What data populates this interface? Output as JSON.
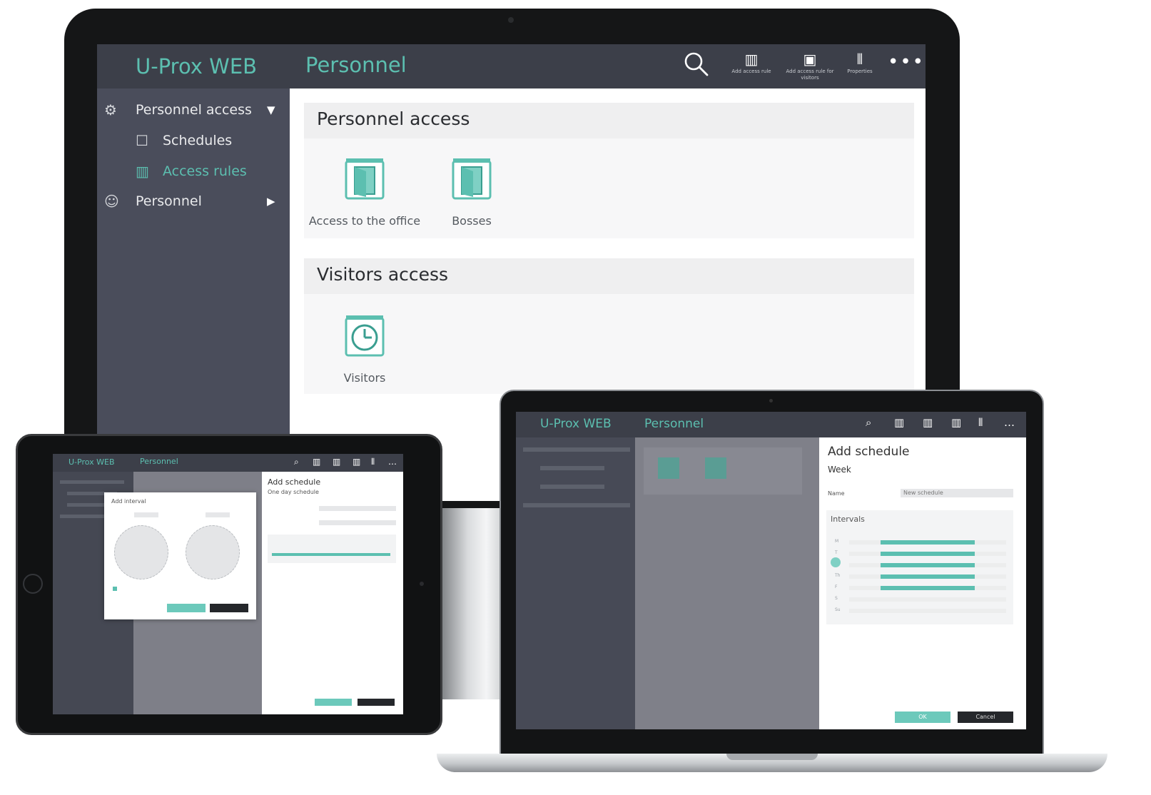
{
  "monitor": {
    "app_title": "U-Prox WEB",
    "section_title": "Personnel",
    "toolbar": {
      "add_access_rule": "Add access rule",
      "add_access_rule_visitors": "Add access rule for visitors",
      "properties": "Properties",
      "more": "•••"
    },
    "sidebar": {
      "items": [
        {
          "label": "Personnel access",
          "icon": "gear-icon",
          "caret": "▼"
        },
        {
          "label": "Schedules",
          "icon": "calendar-icon"
        },
        {
          "label": "Access rules",
          "icon": "door-icon"
        },
        {
          "label": "Personnel",
          "icon": "people-icon",
          "caret": "▶"
        }
      ]
    },
    "groups": [
      {
        "title": "Personnel access",
        "tiles": [
          {
            "label": "Access to the office",
            "icon": "door-icon"
          },
          {
            "label": "Bosses",
            "icon": "door-icon"
          }
        ]
      },
      {
        "title": "Visitors access",
        "tiles": [
          {
            "label": "Visitors",
            "icon": "clock-icon"
          }
        ]
      }
    ]
  },
  "tablet": {
    "app_title": "U-Prox WEB",
    "section_title": "Personnel",
    "dialog_title": "Add interval",
    "panel_title": "Add schedule",
    "panel_subtitle": "One day schedule"
  },
  "laptop": {
    "app_title": "U-Prox WEB",
    "section_title": "Personnel",
    "panel_title": "Add schedule",
    "panel_subtitle": "Week",
    "name_label": "Name",
    "name_value": "New schedule",
    "intervals_title": "Intervals",
    "days": [
      "M",
      "T",
      "W",
      "Th",
      "F",
      "S",
      "Su"
    ],
    "ok_label": "OK",
    "cancel_label": "Cancel"
  },
  "colors": {
    "accent": "#5cbfb0",
    "topbar": "#3c3f49",
    "sidebar": "#4a4d5b"
  }
}
